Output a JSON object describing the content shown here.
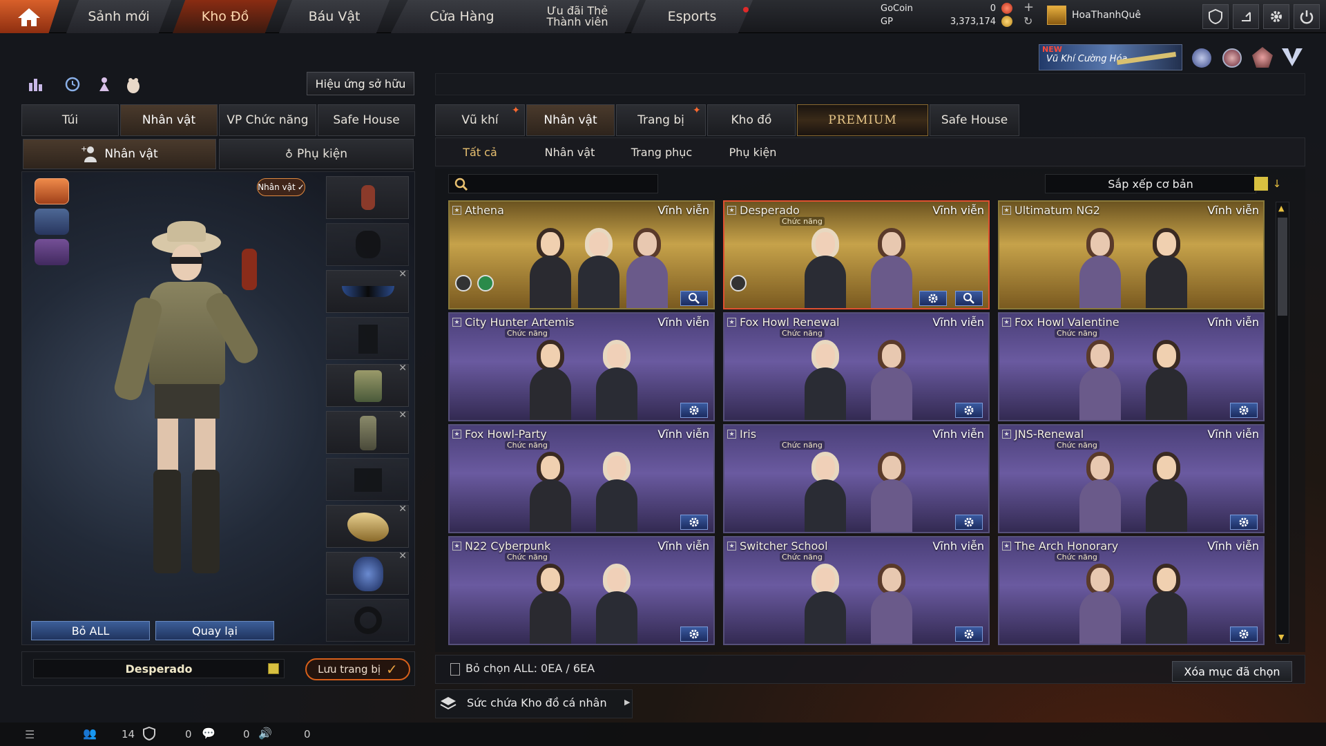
{
  "nav": {
    "tabs": [
      "Sảnh mới",
      "Kho Đồ",
      "Báu Vật",
      "Cửa Hàng",
      "Ưu đãi Thẻ Thành viên",
      "Esports"
    ]
  },
  "currency": {
    "gocoin_label": "GoCoin",
    "gocoin_value": "0",
    "gp_label": "GP",
    "gp_value": "3,373,174"
  },
  "user": {
    "name": "HoaThanhQuê"
  },
  "promo": {
    "badge": "NEW",
    "text": "Vũ Khí Cường Hóa"
  },
  "left": {
    "effect_button": "Hiệu ứng sở hữu",
    "tabs": [
      "Túi",
      "Nhân vật",
      "VP Chức năng",
      "Safe House"
    ],
    "subtabs": [
      "Nhân vật",
      "Phụ kiện"
    ],
    "badge": "Nhân vật",
    "remove_all": "Bỏ ALL",
    "back": "Quay lại",
    "preset_name": "Desperado",
    "save": "Lưu trang bị"
  },
  "right": {
    "tabs": [
      "Vũ khí",
      "Nhân vật",
      "Trang bị",
      "Kho đồ",
      "PREMIUM",
      "Safe House"
    ],
    "subtabs": [
      "Tất cả",
      "Nhân vật",
      "Trang phục",
      "Phụ kiện"
    ],
    "search_placeholder": "",
    "sort": "Sắp xếp cơ bản",
    "deselect": "Bỏ chọn ALL: 0EA / 6EA",
    "delete_selected": "Xóa mục đã chọn",
    "capacity": "Sức chứa Kho đồ cá nhân"
  },
  "cards": [
    {
      "name": "Athena",
      "duration": "Vĩnh viễn",
      "func": ""
    },
    {
      "name": "Desperado",
      "duration": "Vĩnh viễn",
      "func": "Chức năng"
    },
    {
      "name": "Ultimatum NG2",
      "duration": "Vĩnh viễn",
      "func": ""
    },
    {
      "name": "City Hunter Artemis",
      "duration": "Vĩnh viễn",
      "func": "Chức năng"
    },
    {
      "name": "Fox Howl Renewal",
      "duration": "Vĩnh viễn",
      "func": "Chức năng"
    },
    {
      "name": "Fox Howl Valentine",
      "duration": "Vĩnh viễn",
      "func": "Chức năng"
    },
    {
      "name": "Fox Howl-Party",
      "duration": "Vĩnh viễn",
      "func": "Chức năng"
    },
    {
      "name": "Iris",
      "duration": "Vĩnh viễn",
      "func": "Chức năng"
    },
    {
      "name": "JNS-Renewal",
      "duration": "Vĩnh viễn",
      "func": "Chức năng"
    },
    {
      "name": "N22 Cyberpunk",
      "duration": "Vĩnh viễn",
      "func": "Chức năng"
    },
    {
      "name": "Switcher School",
      "duration": "Vĩnh viễn",
      "func": "Chức năng"
    },
    {
      "name": "The Arch Honorary",
      "duration": "Vĩnh viễn",
      "func": "Chức năng"
    }
  ],
  "status": {
    "a": "14",
    "b": "0",
    "c": "0",
    "d": "0"
  },
  "colors": {
    "accent": "#c8501e",
    "card_purple": "#5a4c8a",
    "card_gold": "#b8923c"
  }
}
